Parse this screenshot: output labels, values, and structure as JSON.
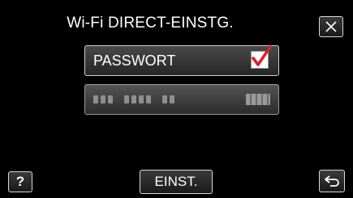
{
  "header": {
    "title": "Wi-Fi DIRECT-EINSTG."
  },
  "rows": [
    {
      "label": "PASSWORT",
      "checked": true
    },
    {
      "value_masked": "●●● ●●●● ●● ●●"
    }
  ],
  "footer": {
    "help_label": "?",
    "set_label": "EINST."
  },
  "icons": {
    "close": "close-icon",
    "back": "back-arrow-icon",
    "check": "checkmark-icon"
  },
  "colors": {
    "background": "#000000",
    "check_mark": "#d8202a",
    "button_border": "#d8d8d8",
    "text": "#ffffff"
  }
}
